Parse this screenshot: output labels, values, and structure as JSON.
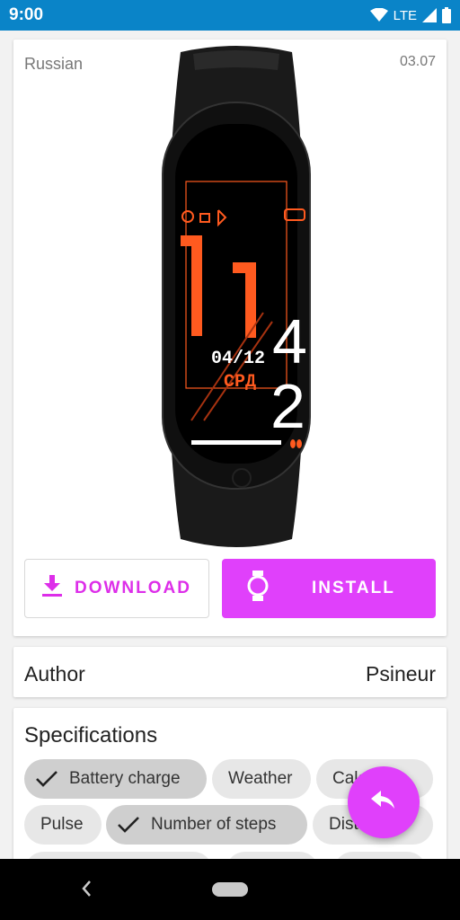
{
  "status_bar": {
    "time": "9:00",
    "network": "LTE"
  },
  "watchface": {
    "language": "Russian",
    "date": "03.07",
    "screen": {
      "hour_digits": "11",
      "minute_top": "4",
      "minute_bottom": "2",
      "date": "04/12",
      "weekday": "СРД"
    }
  },
  "buttons": {
    "download": "DOWNLOAD",
    "install": "INSTALL"
  },
  "author": {
    "label": "Author",
    "value": "Psineur"
  },
  "specifications": {
    "title": "Specifications",
    "chips": [
      {
        "label": "Battery charge",
        "selected": true
      },
      {
        "label": "Weather",
        "selected": false
      },
      {
        "label": "Calories",
        "selected": false
      },
      {
        "label": "Pulse",
        "selected": false
      },
      {
        "label": "Number of steps",
        "selected": true
      },
      {
        "label": "Distance",
        "selected": false
      }
    ]
  },
  "colors": {
    "accent": "#e040fb",
    "status_bar": "#0a84c8",
    "watch_orange": "#ff5a1f"
  }
}
